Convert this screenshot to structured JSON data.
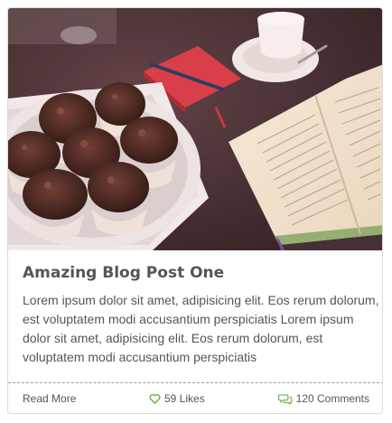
{
  "post": {
    "title": "Amazing Blog Post One",
    "excerpt": "Lorem ipsum dolor sit amet, adipisicing elit. Eos rerum dolorum, est voluptatem modi accusantium perspiciatis Lorem ipsum dolor sit amet, adipisicing elit. Eos rerum dolorum, est voluptatem modi accusantium perspiciatis"
  },
  "footer": {
    "read_more": "Read More",
    "likes": "59 Likes",
    "comments": "120 Comments"
  },
  "icons": {
    "likes": "heart-icon",
    "comments": "comments-icon"
  },
  "colors": {
    "accent": "#6ab04c",
    "text": "#555555",
    "border": "#dcdcdc"
  }
}
